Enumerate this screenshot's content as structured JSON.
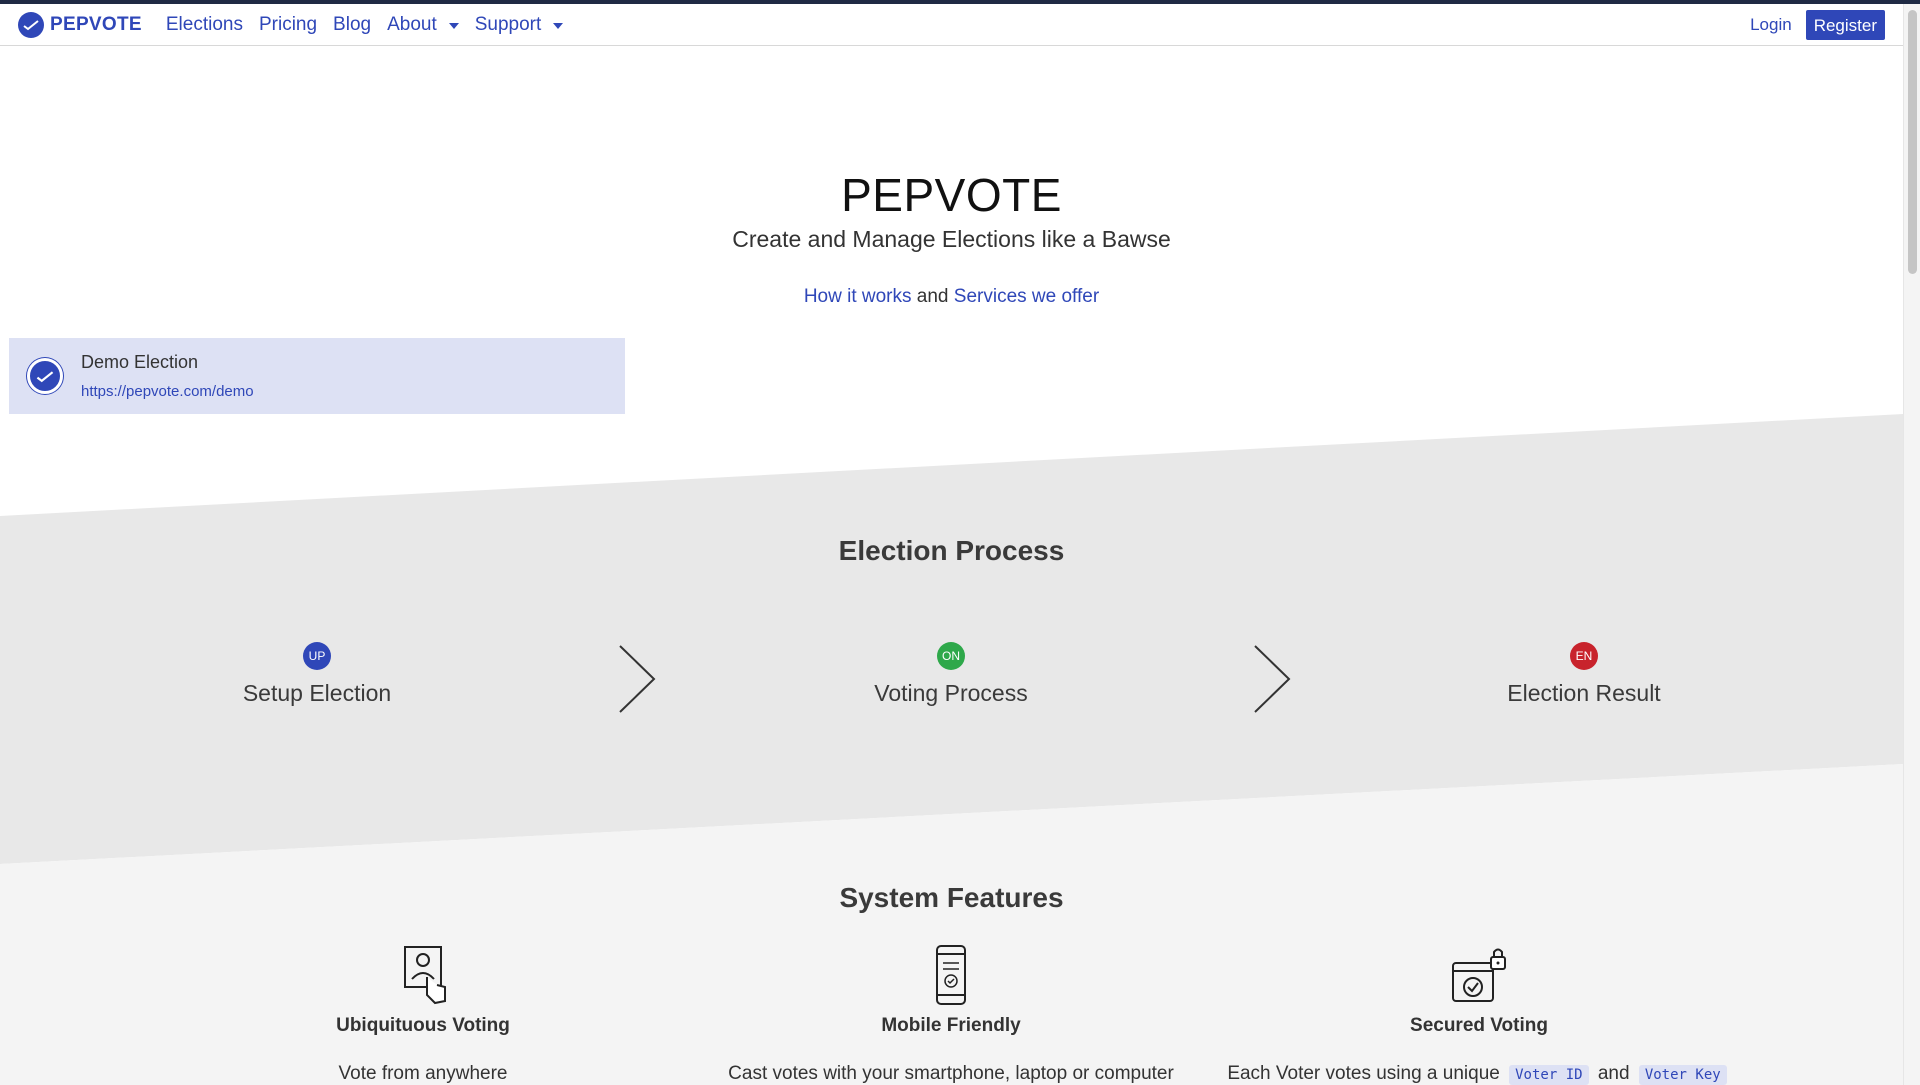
{
  "navbar": {
    "brand": "PEPVOTE",
    "links": [
      {
        "label": "Elections"
      },
      {
        "label": "Pricing"
      },
      {
        "label": "Blog"
      },
      {
        "label": "About"
      },
      {
        "label": "Support"
      }
    ],
    "login": "Login",
    "register": "Register"
  },
  "hero": {
    "title": "PEPVOTE",
    "subtitle": "Create and Manage Elections like a Bawse",
    "link_how": "How it works",
    "and": "and",
    "link_services": "Services we offer"
  },
  "demo": {
    "title": "Demo Election",
    "url": "https://pepvote.com/demo"
  },
  "process": {
    "heading": "Election Process",
    "steps": [
      {
        "badge": "UP",
        "label": "Setup Election",
        "color": "#2f47b8"
      },
      {
        "badge": "ON",
        "label": "Voting Process",
        "color": "#2ea84a"
      },
      {
        "badge": "EN",
        "label": "Election Result",
        "color": "#c8232c"
      }
    ]
  },
  "features": {
    "heading": "System Features",
    "items": [
      {
        "title": "Ubiquituous Voting",
        "desc": "Vote from anywhere",
        "icon": "touch-voter-icon"
      },
      {
        "title": "Mobile Friendly",
        "desc": "Cast votes with your smartphone, laptop or computer",
        "icon": "smartphone-icon"
      },
      {
        "title": "Secured Voting",
        "desc_prefix": "Each Voter votes using a unique",
        "chip1": "Voter ID",
        "and": "and",
        "chip2": "Voter Key",
        "icon": "secure-ballot-icon"
      }
    ]
  },
  "colors": {
    "primary": "#2f47b8",
    "step_up": "#2f47b8",
    "step_on": "#2ea84a",
    "step_en": "#c8232c"
  }
}
